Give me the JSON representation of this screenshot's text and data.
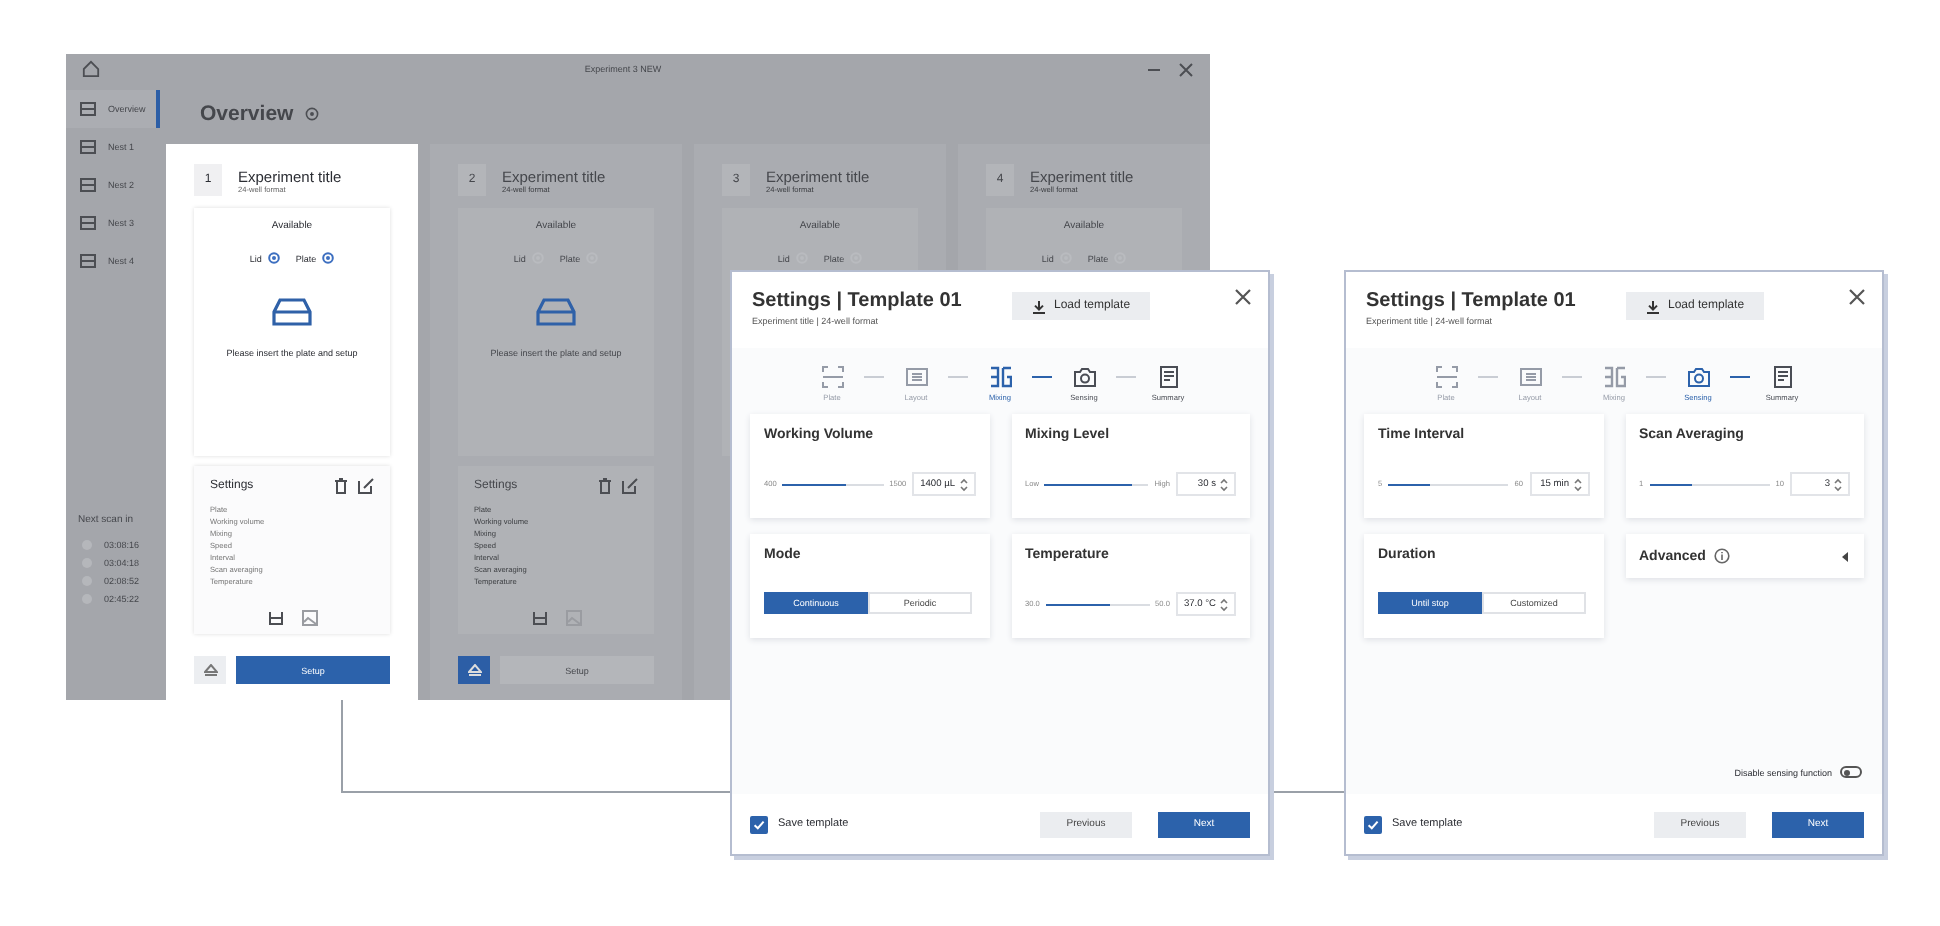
{
  "app": {
    "title": "Experiment 3 NEW",
    "sidebar": {
      "items": [
        {
          "label": "Overview",
          "selected": true
        },
        {
          "label": "Nest 1",
          "selected": false
        },
        {
          "label": "Nest 2",
          "selected": false
        },
        {
          "label": "Nest 3",
          "selected": false
        },
        {
          "label": "Nest 4",
          "selected": false
        }
      ],
      "next_scan": {
        "label": "Next scan in",
        "times": [
          "03:08:16",
          "03:04:18",
          "02:08:52",
          "02:45:22"
        ]
      }
    },
    "header": "Overview",
    "cards": [
      {
        "number": "1",
        "title": "Experiment title",
        "subtitle": "24-well format",
        "focused": true,
        "available": "Available",
        "lid": "Lid",
        "plate": "Plate",
        "message": "Please insert the plate and setup",
        "settings": {
          "title": "Settings",
          "rows": [
            "Plate",
            "Working volume",
            "Mixing",
            "Speed",
            "Interval",
            "Scan averaging",
            "Temperature"
          ]
        },
        "setup": "Setup"
      },
      {
        "number": "2",
        "title": "Experiment title",
        "subtitle": "24-well format",
        "focused": false,
        "available": "Available",
        "lid": "Lid",
        "plate": "Plate",
        "message": "Please insert the plate and setup",
        "settings": {
          "title": "Settings",
          "rows": [
            "Plate",
            "Working volume",
            "Mixing",
            "Speed",
            "Interval",
            "Scan averaging",
            "Temperature"
          ]
        },
        "setup": "Setup"
      },
      {
        "number": "3",
        "title": "Experiment title",
        "subtitle": "24-well format",
        "focused": false,
        "available": "Available",
        "lid": "Lid",
        "plate": "Plate"
      },
      {
        "number": "4",
        "title": "Experiment title",
        "subtitle": "24-well format",
        "focused": false,
        "available": "Available",
        "lid": "Lid",
        "plate": "Plate"
      }
    ]
  },
  "dialogs": [
    {
      "title": "Settings | Template 01",
      "subtitle": "Experiment title | 24-well format",
      "load": "Load template",
      "steps": [
        {
          "label": "Plate",
          "completed": true,
          "selected": false
        },
        {
          "label": "Layout",
          "completed": true,
          "selected": false
        },
        {
          "label": "Mixing",
          "completed": false,
          "selected": true
        },
        {
          "label": "Sensing",
          "completed": false,
          "selected": false
        },
        {
          "label": "Summary",
          "completed": false,
          "selected": false
        }
      ],
      "panels": [
        {
          "kind": "slider",
          "title": "Working Volume",
          "min": "400",
          "max": "1500",
          "level": 0.62,
          "value": "1400 µL"
        },
        {
          "kind": "slider",
          "title": "Mixing Level",
          "min": "Low",
          "max": "High",
          "level": 0.85,
          "value": "30 s"
        },
        {
          "kind": "segmented",
          "title": "Mode",
          "options": [
            {
              "label": "Continuous",
              "selected": true
            },
            {
              "label": "Periodic",
              "selected": false
            }
          ]
        },
        {
          "kind": "slider",
          "title": "Temperature",
          "min": "30.0",
          "max": "50.0",
          "level": 0.62,
          "value": "37.0 °C"
        }
      ],
      "save": {
        "label": "Save template",
        "checked": true
      },
      "previous": "Previous",
      "next": "Next"
    },
    {
      "title": "Settings | Template 01",
      "subtitle": "Experiment title | 24-well format",
      "load": "Load template",
      "steps": [
        {
          "label": "Plate",
          "completed": true,
          "selected": false
        },
        {
          "label": "Layout",
          "completed": true,
          "selected": false
        },
        {
          "label": "Mixing",
          "completed": true,
          "selected": false
        },
        {
          "label": "Sensing",
          "completed": false,
          "selected": true
        },
        {
          "label": "Summary",
          "completed": false,
          "selected": false
        }
      ],
      "panels": [
        {
          "kind": "slider",
          "title": "Time Interval",
          "min": "5",
          "max": "60",
          "level": 0.35,
          "value": "15 min"
        },
        {
          "kind": "slider",
          "title": "Scan Averaging",
          "min": "1",
          "max": "10",
          "level": 0.35,
          "value": "3"
        },
        {
          "kind": "segmented",
          "title": "Duration",
          "options": [
            {
              "label": "Until stop",
              "selected": true
            },
            {
              "label": "Customized",
              "selected": false
            }
          ]
        },
        {
          "kind": "collapsible",
          "title": "Advanced",
          "expanded": false
        }
      ],
      "toggle": {
        "label": "Disable sensing function",
        "on": false
      },
      "save": {
        "label": "Save template",
        "checked": true
      },
      "previous": "Previous",
      "next": "Next"
    }
  ]
}
